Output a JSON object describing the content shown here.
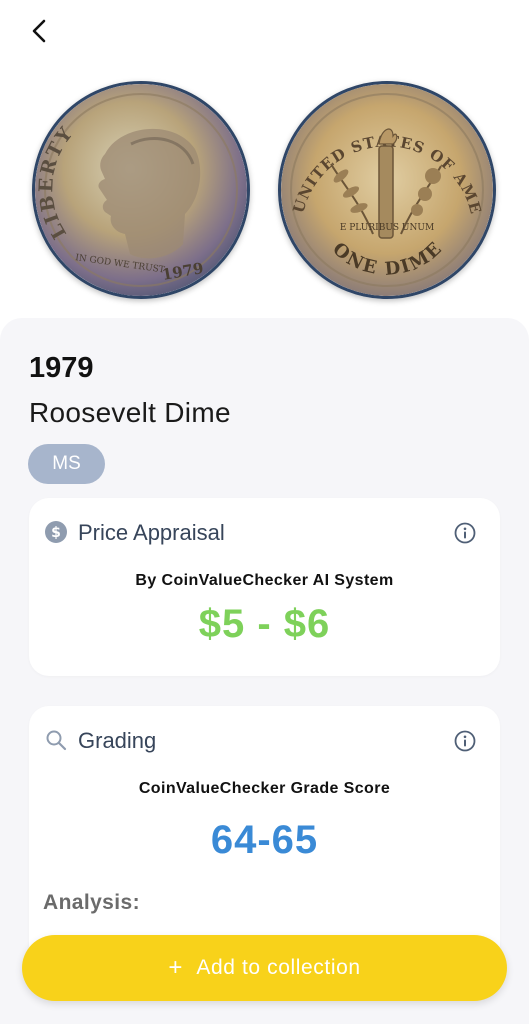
{
  "header": {
    "back_icon": "chevron-left-icon"
  },
  "coin_images": {
    "obverse": {
      "legend": "LIBERTY",
      "motto": "IN GOD WE TRUST",
      "date": "1979"
    },
    "reverse": {
      "legend": "UNITED STATES OF AMERICA",
      "motto": "E PLURIBUS UNUM",
      "denomination": "ONE DIME"
    }
  },
  "coin": {
    "year": "1979",
    "name": "Roosevelt Dime",
    "grade_badge": "MS"
  },
  "price_card": {
    "icon": "dollar-circle-icon",
    "title": "Price Appraisal",
    "subtitle": "By CoinValueChecker AI System",
    "value": "$5 - $6",
    "info_icon": "info-icon",
    "value_color": "#7ed15a"
  },
  "grading_card": {
    "icon": "search-icon",
    "title": "Grading",
    "subtitle": "CoinValueChecker Grade Score",
    "value": "64-65",
    "analysis_label": "Analysis:",
    "info_icon": "info-icon",
    "value_color": "#3a8ad6"
  },
  "cta": {
    "label": "Add to collection",
    "icon": "plus-icon",
    "color": "#f8d21a"
  }
}
